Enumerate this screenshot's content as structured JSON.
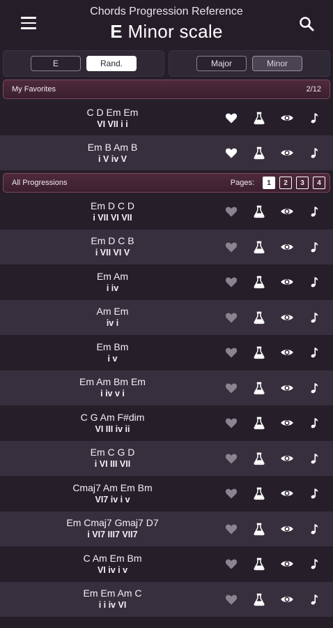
{
  "header": {
    "app_title": "Chords Progression Reference",
    "scale_key": "E",
    "scale_name": "Minor scale",
    "menu_icon": "hamburger-menu-icon",
    "search_icon": "search-icon"
  },
  "controls": {
    "key_button": "E",
    "random_button": "Rand.",
    "major_button": "Major",
    "minor_button": "Minor"
  },
  "favorites": {
    "title": "My Favorites",
    "count": "2/12",
    "items": [
      {
        "chords": "C D Em Em",
        "roman": "VI VII i i"
      },
      {
        "chords": "Em B Am B",
        "roman": "i V iv V"
      }
    ]
  },
  "all": {
    "title": "All Progressions",
    "pages_label": "Pages:",
    "pages": [
      "1",
      "2",
      "3",
      "4"
    ],
    "items": [
      {
        "chords": "Em D C D",
        "roman": "i VII VI VII"
      },
      {
        "chords": "Em D C B",
        "roman": "i VII VI V"
      },
      {
        "chords": "Em Am",
        "roman": "i iv"
      },
      {
        "chords": "Am Em",
        "roman": "iv i"
      },
      {
        "chords": "Em Bm",
        "roman": "i v"
      },
      {
        "chords": "Em Am Bm Em",
        "roman": "i iv v i"
      },
      {
        "chords": "C G Am F#dim",
        "roman": "VI III iv ii"
      },
      {
        "chords": "Em C G D",
        "roman": "i VI III VII"
      },
      {
        "chords": "Cmaj7 Am Em Bm",
        "roman": "VI7 iv i v"
      },
      {
        "chords": "Em Cmaj7 Gmaj7 D7",
        "roman": "i VI7 III7 VII7"
      },
      {
        "chords": "C Am Em Bm",
        "roman": "VI iv i v"
      },
      {
        "chords": "Em Em Am C",
        "roman": "i i iv VI"
      }
    ]
  },
  "colors": {
    "background": "#251e29",
    "row_alt": "#382f3e",
    "section_bar": "#4e2a3a",
    "heart_favorite": "#ffffff",
    "heart_inactive": "#8c8390"
  },
  "icons": {
    "favorite": "heart-icon",
    "lab": "flask-icon",
    "view": "eye-icon",
    "play": "music-note-icon"
  }
}
